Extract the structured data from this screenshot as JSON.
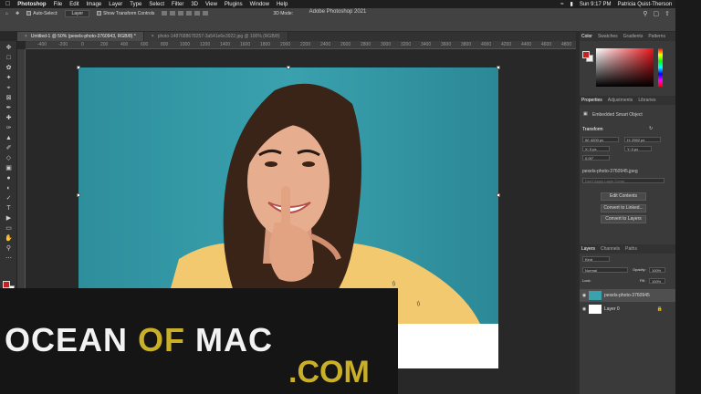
{
  "menubar": {
    "app": "Photoshop",
    "items": [
      "File",
      "Edit",
      "Image",
      "Layer",
      "Type",
      "Select",
      "Filter",
      "3D",
      "View",
      "Plugins",
      "Window",
      "Help"
    ],
    "clock": "Sun 9:17 PM",
    "user": "Patricia Quist-Therson"
  },
  "options": {
    "window_title": "Adobe Photoshop 2021",
    "auto_select": "Auto-Select:",
    "auto_select_target": "Layer",
    "transform_controls": "Show Transform Controls",
    "mode_3d": "3D Mode:"
  },
  "tabs": [
    {
      "label": "Untitled-1 @ 50% (pexels-photo-3760943, RGB/8) *",
      "active": true
    },
    {
      "label": "photo-1487688678257-3a541e6e3922.jpg @ 100% (RGB/8)",
      "active": false
    }
  ],
  "ruler": [
    "-400",
    "-200",
    "0",
    "200",
    "400",
    "600",
    "800",
    "1000",
    "1200",
    "1400",
    "1600",
    "1800",
    "2000",
    "2200",
    "2400",
    "2600",
    "2800",
    "3000",
    "3200",
    "3400",
    "3600",
    "3800",
    "4000",
    "4200",
    "4400",
    "4600",
    "4800",
    "5000",
    "5200"
  ],
  "color_panel": {
    "tabs": [
      "Color",
      "Swatches",
      "Gradients",
      "Patterns"
    ],
    "foreground": "#c8201e",
    "background": "#eeeeee"
  },
  "properties": {
    "tabs": [
      "Properties",
      "Adjustments",
      "Libraries"
    ],
    "kind": "Embedded Smart Object",
    "transform": "Transform",
    "w": "W: 4200 px",
    "h": "H: 2592 px",
    "x": "X: 0 px",
    "y": "Y: 0 px",
    "angle": "0.00°",
    "file": "pexels-photo-3760945.jpeg",
    "comp_placeholder": "Don't Apply Layer Comp",
    "edit_contents": "Edit Contents",
    "convert_linked": "Convert to Linked...",
    "convert_layers": "Convert to Layers"
  },
  "layers": {
    "tabs": [
      "Layers",
      "Channels",
      "Paths"
    ],
    "filter": "Kind",
    "blend": "Normal",
    "opacity_label": "Opacity:",
    "opacity": "100%",
    "lock_label": "Lock:",
    "fill_label": "Fill:",
    "fill": "100%",
    "items": [
      {
        "name": "pexels-photo-3760945",
        "selected": true
      },
      {
        "name": "Layer 0",
        "selected": false
      }
    ]
  },
  "watermark": {
    "ocean": "OCEAN",
    "of": "OF",
    "mac": "MAC",
    "com": ".COM"
  }
}
